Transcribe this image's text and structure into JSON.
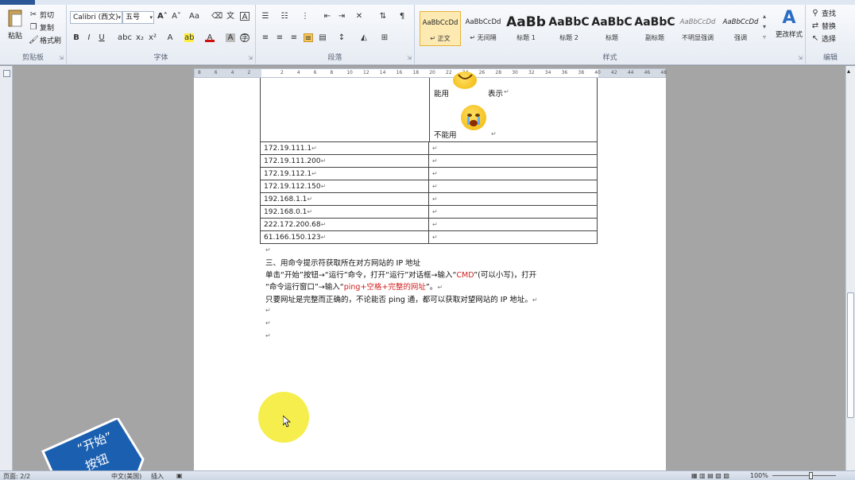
{
  "ribbon": {
    "clipboard": {
      "paste": "粘贴",
      "cut": "剪切",
      "copy": "复制",
      "format_painter": "格式刷",
      "label": "剪贴板"
    },
    "font": {
      "name": "Calibri (西文)",
      "size": "五号",
      "label": "字体"
    },
    "paragraph": {
      "label": "段落"
    },
    "styles": {
      "label": "样式",
      "items": [
        {
          "preview": "AaBbCcDd",
          "name": "↵ 正文"
        },
        {
          "preview": "AaBbCcDd",
          "name": "↵ 无间隔"
        },
        {
          "preview": "AaBb",
          "name": "标题 1"
        },
        {
          "preview": "AaBbC",
          "name": "标题 2"
        },
        {
          "preview": "AaBbC",
          "name": "标题"
        },
        {
          "preview": "AaBbC",
          "name": "副标题"
        },
        {
          "preview": "AaBbCcDd",
          "name": "不明显强调"
        },
        {
          "preview": "AaBbCcDd",
          "name": "强调"
        }
      ],
      "change_styles": "更改样式"
    },
    "editing": {
      "find": "查找",
      "replace": "替换",
      "select": "选择",
      "label": "编辑"
    }
  },
  "ruler": {
    "ticks": [
      "8",
      "6",
      "4",
      "2",
      "",
      "2",
      "4",
      "6",
      "8",
      "10",
      "12",
      "14",
      "16",
      "18",
      "20",
      "22",
      "24",
      "26",
      "28",
      "30",
      "32",
      "34",
      "36",
      "38",
      "40",
      "42",
      "44",
      "46",
      "48"
    ]
  },
  "document": {
    "status_text": {
      "can_use": "能用",
      "shows": "表示",
      "cannot_use": "不能用"
    },
    "table_rows": [
      {
        "ip": "172.19.111.1"
      },
      {
        "ip": "172.19.111.200"
      },
      {
        "ip": "172.19.112.1"
      },
      {
        "ip": "172.19.112.150"
      },
      {
        "ip": "192.168.1.1"
      },
      {
        "ip": "192.168.0.1"
      },
      {
        "ip": "222.172.200.68"
      },
      {
        "ip": "61.166.150.123"
      }
    ],
    "heading": "三、用命令提示符获取所在对方网站的 IP 地址",
    "line1a": "单击“开始”按钮→“运行”命令，打开“运行”对话框→输入“",
    "line1_cmd": "CMD",
    "line1b": "”(可以小写)，打开",
    "line2a": "“命令运行窗口”→输入“",
    "line2_ping": "ping+空格+完整的网址",
    "line2b": "”。",
    "line3": "只要网址是完整而正确的，不论能否 ping 通，都可以获取对望网站的 IP 地址。",
    "para_mark": "↵"
  },
  "badge": {
    "line1": "“开始”",
    "line2": "按钮"
  },
  "status": {
    "page": "页面: 2/2",
    "lang": "中文(美国)",
    "mode": "插入",
    "zoom": "100%"
  }
}
